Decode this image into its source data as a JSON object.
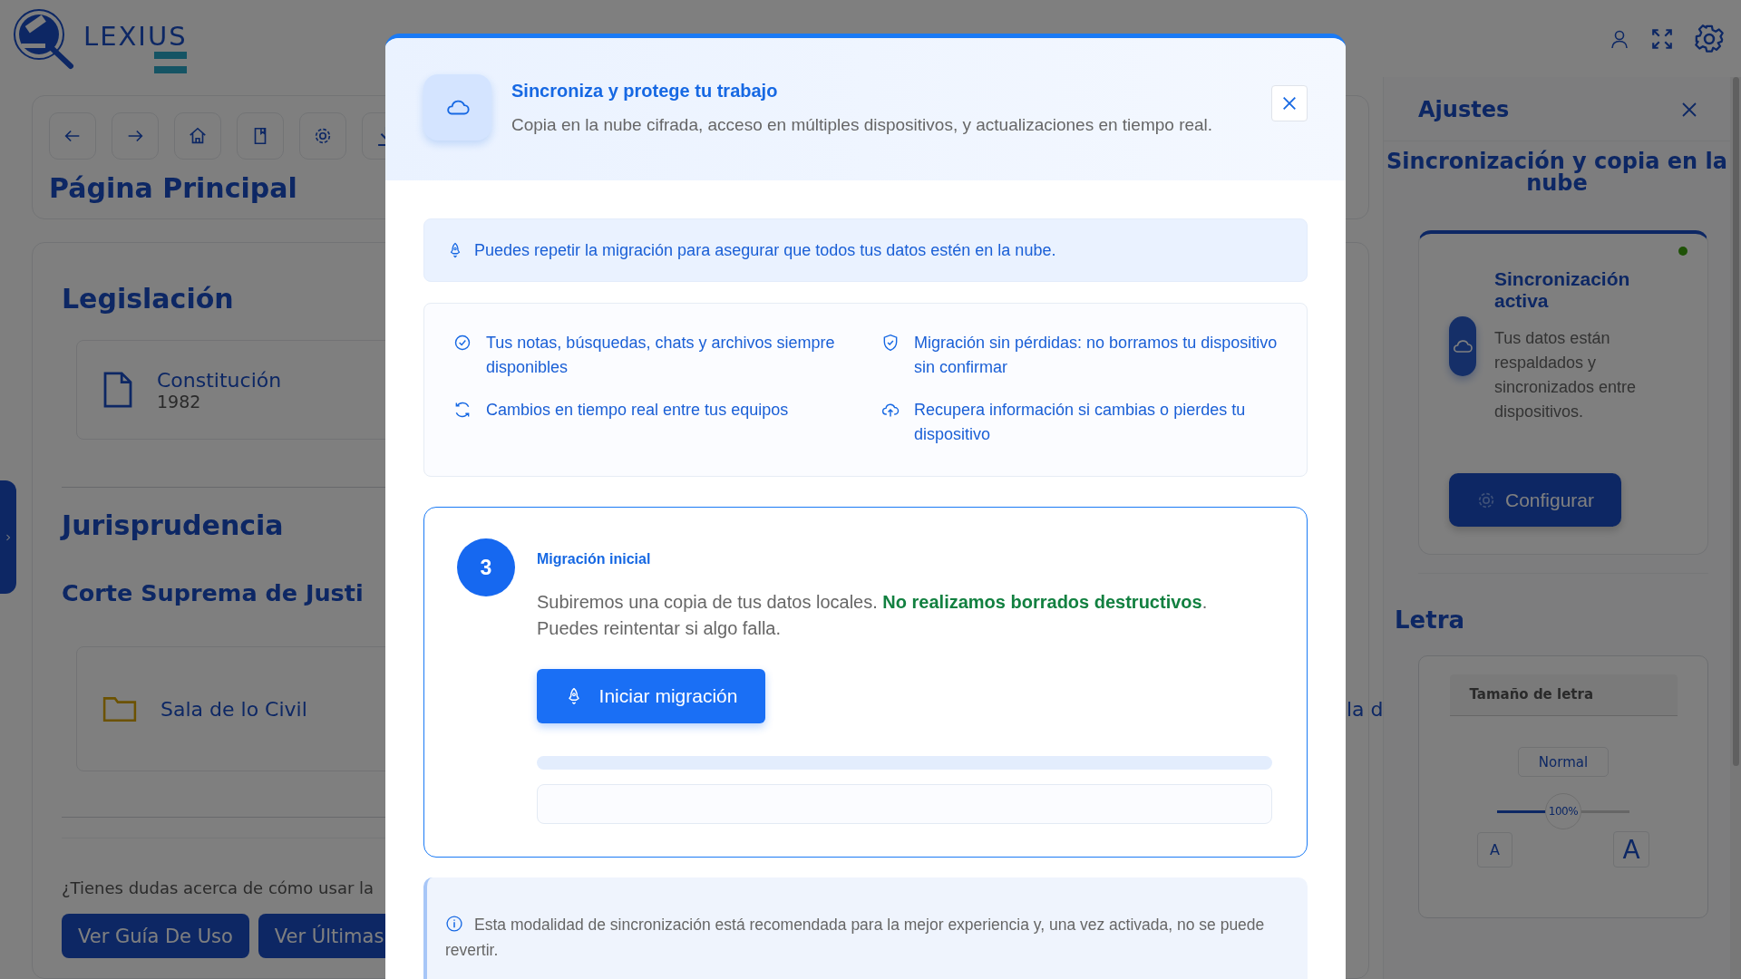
{
  "app": {
    "logo": "LEXIUS",
    "page_title": "Página Principal"
  },
  "main": {
    "legislation": {
      "heading": "Legislación",
      "items": [
        {
          "kind": "document",
          "title": "Constitución",
          "subtitle": "1982"
        }
      ]
    },
    "jurisprudence": {
      "heading": "Jurisprudencia",
      "court": "Corte Suprema de Justi",
      "items": [
        {
          "kind": "folder",
          "title": "Sala de lo Civil"
        }
      ],
      "cut_item": "la d"
    },
    "help": {
      "text": "¿Tienes dudas acerca de cómo usar la",
      "buttons": [
        "Ver Guía De Uso",
        "Ver Últimas"
      ]
    }
  },
  "settings_panel": {
    "title": "Ajustes",
    "sync_heading": "Sincronización y copia en la nube",
    "sync_card": {
      "title": "Sincronización activa",
      "text": "Tus datos están respaldados y sincronizados entre dispositivos.",
      "active": true,
      "button": "Configurar"
    },
    "font_heading": "Letra",
    "font_card": {
      "title": "Tamaño de letra",
      "preset": "Normal",
      "reading": "100%",
      "level": 0.5,
      "small_key": "A",
      "large_key": "A"
    }
  },
  "modal": {
    "title": "Sincroniza y protege tu trabajo",
    "subtitle": "Copia en la nube cifrada, acceso en múltiples dispositivos, y actualizaciones en tiempo real.",
    "notice": "Puedes repetir la migración para asegurar que todos tus datos estén en la nube.",
    "features": [
      {
        "kind": "check",
        "text": "Tus notas, búsquedas, chats y archivos siempre disponibles"
      },
      {
        "kind": "shield",
        "text": "Migración sin pérdidas: no borramos tu dispositivo sin confirmar"
      },
      {
        "kind": "sync",
        "text": "Cambios en tiempo real entre tus equipos"
      },
      {
        "kind": "upload",
        "text": "Recupera información si cambias o pierdes tu dispositivo"
      }
    ],
    "step": {
      "number": "3",
      "title": "Migración inicial",
      "text": "Subiremos una copia de tus datos locales. **No realizamos borrados destructivos**. Puedes reintentar si algo falla.",
      "button": "Iniciar migración",
      "level": 0
    },
    "footer_note": "Esta modalidad de sincronización está recomendada para la mejor experiencia y, una vez activada, no se puede revertir."
  }
}
